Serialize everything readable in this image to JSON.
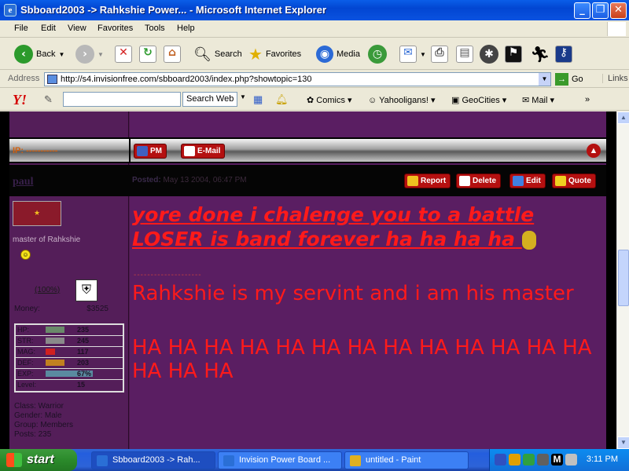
{
  "window": {
    "title": "Sbboard2003 -> Rahkshie Power... - Microsoft Internet Explorer",
    "minimize": "_",
    "maximize": "❐",
    "close": "✕"
  },
  "menu": [
    "File",
    "Edit",
    "View",
    "Favorites",
    "Tools",
    "Help"
  ],
  "toolbar": {
    "back": "Back",
    "search": "Search",
    "favorites": "Favorites",
    "media": "Media"
  },
  "address": {
    "label": "Address",
    "url": "http://s4.invisionfree.com/sbboard2003/index.php?showtopic=130",
    "go": "Go",
    "links": "Links"
  },
  "yahoo": {
    "logo": "Y!",
    "search_web": "Search Web",
    "links": [
      "Comics",
      "Yahooligans!",
      "GeoCities",
      "Mail"
    ]
  },
  "post": {
    "ip": "IP: -----------",
    "pm": "PM",
    "email": "E-Mail",
    "username": "paul",
    "posted_label": "Posted:",
    "posted_date": "May 13 2004, 06:47 PM",
    "actions": [
      "Report",
      "Delete",
      "Edit",
      "Quote"
    ],
    "user_title": "master of Rahkshie",
    "percent": "(100%)",
    "money_label": "Money:",
    "money_value": "$3525",
    "stats": [
      {
        "key": "HP:",
        "value": "235"
      },
      {
        "key": "STR:",
        "value": "245"
      },
      {
        "key": "MAG:",
        "value": "117"
      },
      {
        "key": "DEF:",
        "value": "203"
      },
      {
        "key": "EXP:",
        "value": "67%"
      },
      {
        "key": "Level:",
        "value": "15"
      }
    ],
    "class_line": "Class: Warrior",
    "gender_line": "Gender: Male",
    "group_line": "Group: Members",
    "posts_line": "Posts: 235",
    "body_line1": "yore done i chalenge you to a battle",
    "body_line2": "LOSER is band forever ha ha ha ha",
    "signature_sep": "--------------------",
    "body_para2": "Rahkshie is my servint and i am his master",
    "body_para3": "HA HA HA HA HA HA HA HA HA HA HA HA HA HA HA HA"
  },
  "taskbar": {
    "start": "start",
    "tasks": [
      "Sbboard2003 -> Rah...",
      "Invision Power Board ...",
      "untitled - Paint"
    ],
    "clock": "3:11 PM"
  },
  "colors": {
    "post_text": "#ff1a1a",
    "forum_bg": "#5a1e62",
    "xp_blue": "#0246d2"
  }
}
